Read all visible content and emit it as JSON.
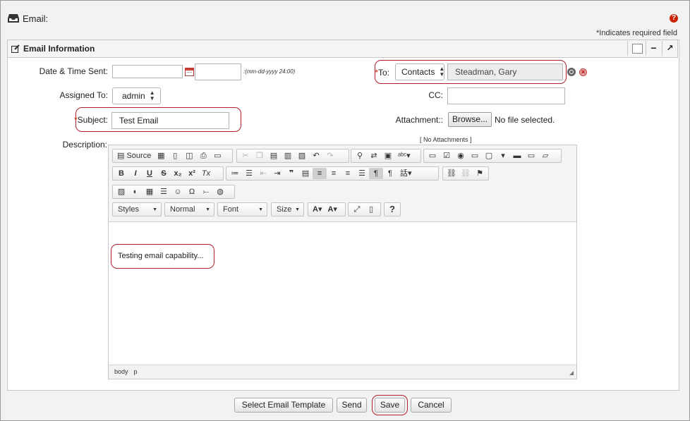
{
  "page": {
    "title": "Email:",
    "help_glyph": "?",
    "required_note": "*Indicates required field"
  },
  "panel": {
    "title": "Email Information",
    "minimize_glyph": "−",
    "expand_glyph": "↗"
  },
  "form": {
    "date_time": {
      "label": "Date & Time Sent:",
      "date_value": "",
      "time_value": "",
      "format_hint": ":(mm-dd-yyyy 24:00)"
    },
    "to": {
      "required_mark": "*",
      "label": "To:",
      "type_selected": "Contacts",
      "value": "Steadman, Gary"
    },
    "assigned_to": {
      "label": "Assigned To:",
      "selected": "admin"
    },
    "cc": {
      "label": "CC:",
      "value": ""
    },
    "subject": {
      "required_mark": "*",
      "label": "Subject:",
      "value": "Test Email"
    },
    "attachment": {
      "label": "Attachment::",
      "browse_label": "Browse...",
      "file_status": "No file selected.",
      "no_attachments": "[ No Attachments ]"
    },
    "description": {
      "label": "Description:"
    }
  },
  "editor": {
    "source_label": "Source",
    "bold": "B",
    "italic": "I",
    "underline": "U",
    "strike": "S",
    "subscript": "x₂",
    "superscript": "x²",
    "remove_format": "Tx",
    "help": "?",
    "combos": {
      "styles": "Styles",
      "format": "Normal",
      "font": "Font",
      "size": "Size"
    },
    "content": "Testing email capability...",
    "status_path": [
      "body",
      "p"
    ]
  },
  "buttons": {
    "template": "Select Email Template",
    "send": "Send",
    "save": "Save",
    "cancel": "Cancel"
  },
  "colors": {
    "highlight": "#b0202a",
    "required": "#cc2200"
  }
}
